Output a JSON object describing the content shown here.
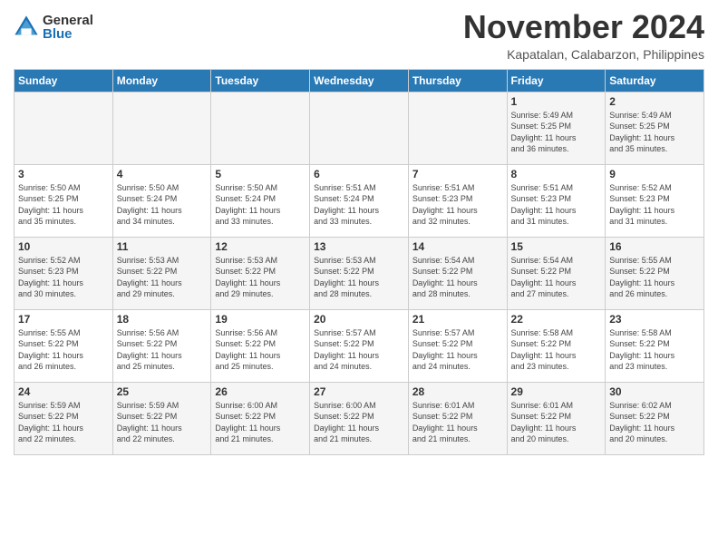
{
  "logo": {
    "general": "General",
    "blue": "Blue"
  },
  "title": "November 2024",
  "location": "Kapatalan, Calabarzon, Philippines",
  "weekdays": [
    "Sunday",
    "Monday",
    "Tuesday",
    "Wednesday",
    "Thursday",
    "Friday",
    "Saturday"
  ],
  "weeks": [
    [
      {
        "day": "",
        "info": ""
      },
      {
        "day": "",
        "info": ""
      },
      {
        "day": "",
        "info": ""
      },
      {
        "day": "",
        "info": ""
      },
      {
        "day": "",
        "info": ""
      },
      {
        "day": "1",
        "info": "Sunrise: 5:49 AM\nSunset: 5:25 PM\nDaylight: 11 hours\nand 36 minutes."
      },
      {
        "day": "2",
        "info": "Sunrise: 5:49 AM\nSunset: 5:25 PM\nDaylight: 11 hours\nand 35 minutes."
      }
    ],
    [
      {
        "day": "3",
        "info": "Sunrise: 5:50 AM\nSunset: 5:25 PM\nDaylight: 11 hours\nand 35 minutes."
      },
      {
        "day": "4",
        "info": "Sunrise: 5:50 AM\nSunset: 5:24 PM\nDaylight: 11 hours\nand 34 minutes."
      },
      {
        "day": "5",
        "info": "Sunrise: 5:50 AM\nSunset: 5:24 PM\nDaylight: 11 hours\nand 33 minutes."
      },
      {
        "day": "6",
        "info": "Sunrise: 5:51 AM\nSunset: 5:24 PM\nDaylight: 11 hours\nand 33 minutes."
      },
      {
        "day": "7",
        "info": "Sunrise: 5:51 AM\nSunset: 5:23 PM\nDaylight: 11 hours\nand 32 minutes."
      },
      {
        "day": "8",
        "info": "Sunrise: 5:51 AM\nSunset: 5:23 PM\nDaylight: 11 hours\nand 31 minutes."
      },
      {
        "day": "9",
        "info": "Sunrise: 5:52 AM\nSunset: 5:23 PM\nDaylight: 11 hours\nand 31 minutes."
      }
    ],
    [
      {
        "day": "10",
        "info": "Sunrise: 5:52 AM\nSunset: 5:23 PM\nDaylight: 11 hours\nand 30 minutes."
      },
      {
        "day": "11",
        "info": "Sunrise: 5:53 AM\nSunset: 5:22 PM\nDaylight: 11 hours\nand 29 minutes."
      },
      {
        "day": "12",
        "info": "Sunrise: 5:53 AM\nSunset: 5:22 PM\nDaylight: 11 hours\nand 29 minutes."
      },
      {
        "day": "13",
        "info": "Sunrise: 5:53 AM\nSunset: 5:22 PM\nDaylight: 11 hours\nand 28 minutes."
      },
      {
        "day": "14",
        "info": "Sunrise: 5:54 AM\nSunset: 5:22 PM\nDaylight: 11 hours\nand 28 minutes."
      },
      {
        "day": "15",
        "info": "Sunrise: 5:54 AM\nSunset: 5:22 PM\nDaylight: 11 hours\nand 27 minutes."
      },
      {
        "day": "16",
        "info": "Sunrise: 5:55 AM\nSunset: 5:22 PM\nDaylight: 11 hours\nand 26 minutes."
      }
    ],
    [
      {
        "day": "17",
        "info": "Sunrise: 5:55 AM\nSunset: 5:22 PM\nDaylight: 11 hours\nand 26 minutes."
      },
      {
        "day": "18",
        "info": "Sunrise: 5:56 AM\nSunset: 5:22 PM\nDaylight: 11 hours\nand 25 minutes."
      },
      {
        "day": "19",
        "info": "Sunrise: 5:56 AM\nSunset: 5:22 PM\nDaylight: 11 hours\nand 25 minutes."
      },
      {
        "day": "20",
        "info": "Sunrise: 5:57 AM\nSunset: 5:22 PM\nDaylight: 11 hours\nand 24 minutes."
      },
      {
        "day": "21",
        "info": "Sunrise: 5:57 AM\nSunset: 5:22 PM\nDaylight: 11 hours\nand 24 minutes."
      },
      {
        "day": "22",
        "info": "Sunrise: 5:58 AM\nSunset: 5:22 PM\nDaylight: 11 hours\nand 23 minutes."
      },
      {
        "day": "23",
        "info": "Sunrise: 5:58 AM\nSunset: 5:22 PM\nDaylight: 11 hours\nand 23 minutes."
      }
    ],
    [
      {
        "day": "24",
        "info": "Sunrise: 5:59 AM\nSunset: 5:22 PM\nDaylight: 11 hours\nand 22 minutes."
      },
      {
        "day": "25",
        "info": "Sunrise: 5:59 AM\nSunset: 5:22 PM\nDaylight: 11 hours\nand 22 minutes."
      },
      {
        "day": "26",
        "info": "Sunrise: 6:00 AM\nSunset: 5:22 PM\nDaylight: 11 hours\nand 21 minutes."
      },
      {
        "day": "27",
        "info": "Sunrise: 6:00 AM\nSunset: 5:22 PM\nDaylight: 11 hours\nand 21 minutes."
      },
      {
        "day": "28",
        "info": "Sunrise: 6:01 AM\nSunset: 5:22 PM\nDaylight: 11 hours\nand 21 minutes."
      },
      {
        "day": "29",
        "info": "Sunrise: 6:01 AM\nSunset: 5:22 PM\nDaylight: 11 hours\nand 20 minutes."
      },
      {
        "day": "30",
        "info": "Sunrise: 6:02 AM\nSunset: 5:22 PM\nDaylight: 11 hours\nand 20 minutes."
      }
    ]
  ]
}
